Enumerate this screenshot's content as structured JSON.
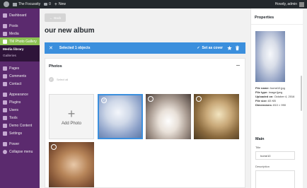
{
  "adminbar": {
    "site_name": "The Focussity",
    "comments_count": "0",
    "new_label": "New",
    "greeting": "Howdy, admin"
  },
  "sidebar": {
    "items": [
      {
        "label": "Dashboard",
        "icon": "dashboard-icon"
      },
      {
        "label": "Posts",
        "icon": "pin-icon"
      },
      {
        "label": "Media",
        "icon": "media-icon"
      },
      {
        "label": "TM Photo Gallery",
        "icon": "gallery-icon",
        "active": true
      }
    ],
    "submenu": [
      "Media library",
      "Galleries"
    ],
    "items2": [
      {
        "label": "Pages",
        "icon": "page-icon"
      },
      {
        "label": "Comments",
        "icon": "comment-icon"
      },
      {
        "label": "Contact",
        "icon": "mail-icon"
      },
      {
        "label": "Appearance",
        "icon": "brush-icon"
      },
      {
        "label": "Plugins",
        "icon": "plugin-icon"
      },
      {
        "label": "Users",
        "icon": "users-icon"
      },
      {
        "label": "Tools",
        "icon": "wrench-icon"
      },
      {
        "label": "Demo Content",
        "icon": "download-icon"
      },
      {
        "label": "Settings",
        "icon": "settings-icon"
      },
      {
        "label": "Power",
        "icon": "power-icon"
      },
      {
        "label": "Collapse menu",
        "icon": "collapse-icon"
      }
    ]
  },
  "main": {
    "back_label": "Back",
    "album_title": "our new album",
    "selection_text": "Selected 1 objects",
    "set_cover_label": "Set as cover",
    "photos_heading": "Photos",
    "select_all_label": "Select all",
    "add_photo_label": "Add Photo"
  },
  "props": {
    "heading": "Properties",
    "file_name_label": "File name:",
    "file_name": "home10.jpg",
    "file_type_label": "File type:",
    "file_type": "image/jpeg",
    "uploaded_label": "Uploaded on:",
    "uploaded": "October 4, 2016",
    "file_size_label": "File size:",
    "file_size": "83 KB",
    "dimensions_label": "Dimensions:",
    "dimensions": "810 × 990",
    "main_heading": "Main",
    "title_label": "Title",
    "title_value": "home10",
    "description_label": "Description"
  },
  "colors": {
    "sidebar": "#5b2a6e",
    "active_menu": "#8cc152",
    "selection_bar": "#3b8fdd",
    "adminbar": "#23282d"
  }
}
